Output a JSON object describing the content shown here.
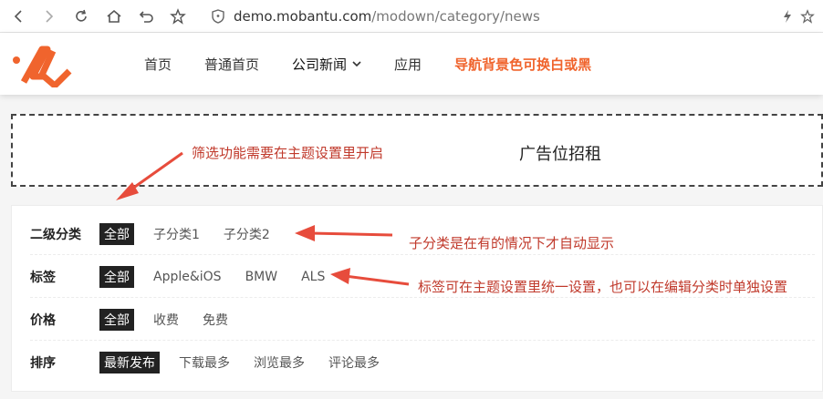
{
  "browser": {
    "url_domain": "demo.mobantu.com",
    "url_path": "/modown/category/news"
  },
  "nav": {
    "items": [
      "首页",
      "普通首页",
      "公司新闻",
      "应用",
      "导航背景色可换白或黑"
    ]
  },
  "ad": {
    "text": "广告位招租"
  },
  "filters": {
    "rows": [
      {
        "label": "二级分类",
        "options": [
          "全部",
          "子分类1",
          "子分类2"
        ],
        "active": 0
      },
      {
        "label": "标签",
        "options": [
          "全部",
          "Apple&iOS",
          "BMW",
          "ALS"
        ],
        "active": 0
      },
      {
        "label": "价格",
        "options": [
          "全部",
          "收费",
          "免费"
        ],
        "active": 0
      },
      {
        "label": "排序",
        "options": [
          "最新发布",
          "下载最多",
          "浏览最多",
          "评论最多"
        ],
        "active": 0
      }
    ]
  },
  "annotations": {
    "filter_note": "筛选功能需要在主题设置里开启",
    "subcat_note": "子分类是在有的情况下才自动显示",
    "tag_note": "标签可在主题设置里统一设置，也可以在编辑分类时单独设置"
  },
  "colors": {
    "accent": "#f0642d",
    "annotation": "#c0392b",
    "active_bg": "#222222"
  }
}
